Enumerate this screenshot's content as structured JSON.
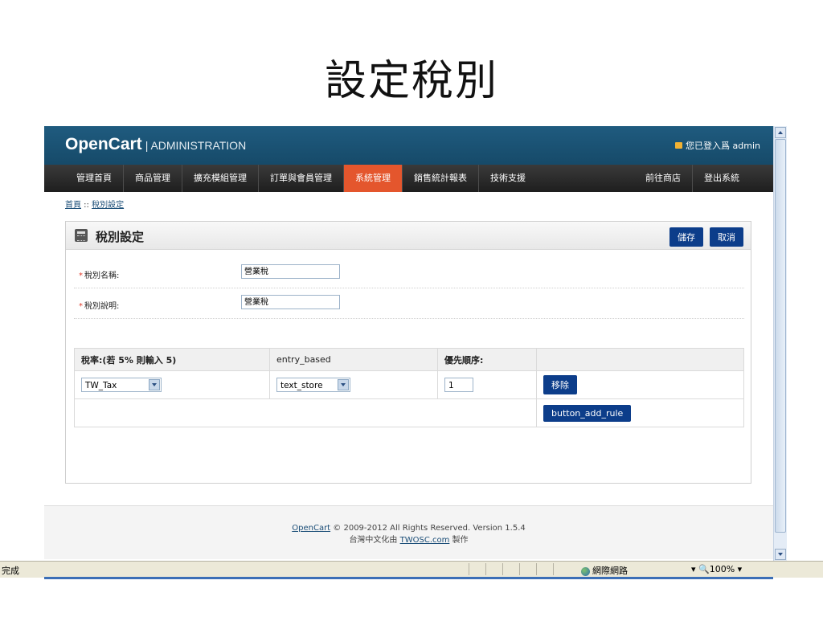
{
  "slide_title": "設定稅別",
  "header": {
    "logo": "OpenCart",
    "logo_sub": "| ADMINISTRATION",
    "login_info": "您已登入爲 admin"
  },
  "menu": {
    "left": [
      "管理首頁",
      "商品管理",
      "擴充模組管理",
      "訂單與會員管理",
      "系統管理",
      "銷售統計報表",
      "技術支援"
    ],
    "active": "系統管理",
    "right": [
      "前往商店",
      "登出系統"
    ]
  },
  "breadcrumb": {
    "home": "首頁",
    "separator": " :: ",
    "current": "稅別設定"
  },
  "box": {
    "title": "稅別設定",
    "save_label": "儲存",
    "cancel_label": "取消"
  },
  "form": {
    "name_label": "稅別名稱:",
    "name_value": "營業稅",
    "desc_label": "稅別說明:",
    "desc_value": "營業稅"
  },
  "rules": {
    "headers": [
      "稅率:(若 5% 則輸入 5)",
      "entry_based",
      "優先順序:",
      ""
    ],
    "row": {
      "rate": "TW_Tax",
      "based": "text_store",
      "priority": "1",
      "remove_label": "移除"
    },
    "add_rule_label": "button_add_rule"
  },
  "footer": {
    "link1": "OpenCart",
    "line1_rest": " © 2009-2012 All Rights Reserved. Version 1.5.4",
    "line2_pre": "台灣中文化由 ",
    "link2": "TWOSC.com",
    "line2_post": " 製作"
  },
  "statusbar": {
    "status": "完成",
    "zone": "網際網路",
    "zoom": "100%"
  },
  "colors": {
    "header": "#1f5b7f",
    "active_menu": "#e4562d",
    "button": "#0c3d8a"
  }
}
